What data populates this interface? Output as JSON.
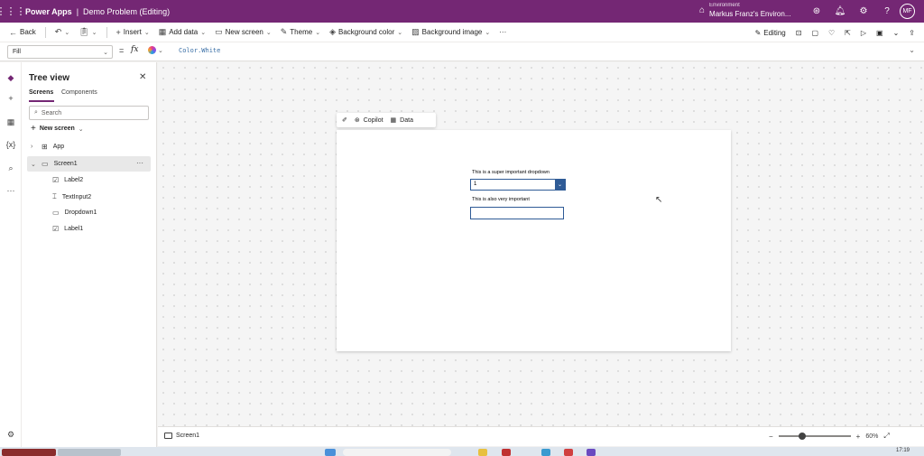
{
  "topbar": {
    "app_name": "Power Apps",
    "separator": "|",
    "document_title": "Demo Problem (Editing)",
    "environment_label": "Environment",
    "environment_name": "Markus Franz's Environ...",
    "avatar_initials": "MF",
    "brand_color": "#742774"
  },
  "commandbar": {
    "back": "Back",
    "insert": "Insert",
    "add_data": "Add data",
    "new_screen": "New screen",
    "theme": "Theme",
    "background_color": "Background color",
    "background_image": "Background image",
    "more": "···",
    "editing": "Editing"
  },
  "formulabar": {
    "property": "Fill",
    "equals": "=",
    "fx": "fx",
    "formula": "Color.White"
  },
  "treeview": {
    "title": "Tree view",
    "tabs": [
      "Screens",
      "Components"
    ],
    "search_placeholder": "Search",
    "new_screen": "New screen",
    "nodes": [
      {
        "name": "App",
        "icon": "app-grid-icon"
      },
      {
        "name": "Screen1",
        "icon": "screen-icon",
        "selected": true
      },
      {
        "name": "Label2",
        "icon": "label-icon"
      },
      {
        "name": "TextInput2",
        "icon": "textinput-icon"
      },
      {
        "name": "Dropdown1",
        "icon": "dropdown-icon"
      },
      {
        "name": "Label1",
        "icon": "label-icon"
      }
    ],
    "more": "···"
  },
  "canvas": {
    "toolbar": {
      "copilot": "Copilot",
      "data": "Data"
    },
    "label1_text": "This is a super important dropdown",
    "dropdown_value": "1",
    "label2_text": "This is also very important",
    "control_border_color": "#2f5b96"
  },
  "statusbar": {
    "screen_name": "Screen1",
    "zoom_level": "60%"
  },
  "taskbar": {
    "time": "17:19"
  }
}
